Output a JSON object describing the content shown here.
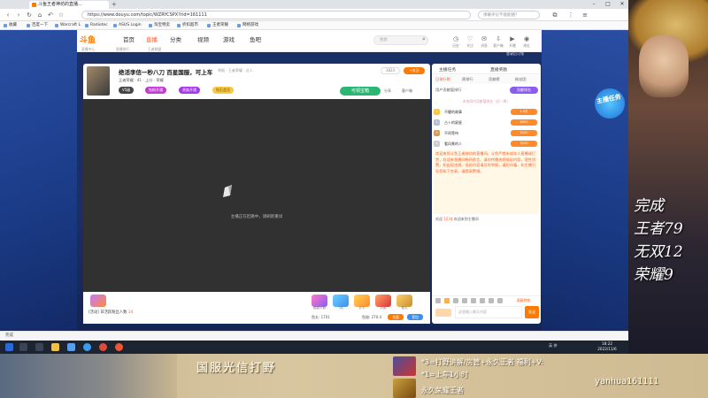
{
  "browser": {
    "tab_title": "斗鱼王者神坊的直播...",
    "url": "https://www.douyu.com/topic/WZRYCSPX?rid=161111",
    "search_placeholder": "弹幕评论不能能播？"
  },
  "bookmarks": [
    "收藏",
    "百度一下",
    "Warcraft L",
    "Radiotec",
    "ASUS Login",
    "淘宝特卖",
    "折扣超市",
    "王者荣耀",
    "网络游戏"
  ],
  "site": {
    "logo": "斗鱼",
    "nav": [
      "首页",
      "直播",
      "分类",
      "视频",
      "游戏",
      "鱼吧"
    ],
    "active_nav": "直播",
    "subnav": [
      "直播中心",
      "直播排行",
      "王者联盟"
    ],
    "search_placeholder": "搜索",
    "header_icons": [
      {
        "icon": "history-icon",
        "label": "历史"
      },
      {
        "icon": "follow-icon",
        "label": "关注"
      },
      {
        "icon": "message-icon",
        "label": "消息"
      },
      {
        "icon": "download-icon",
        "label": "客户端"
      },
      {
        "icon": "live-icon",
        "label": "开播"
      },
      {
        "icon": "location-icon",
        "label": "地址"
      }
    ],
    "login_hint": "登录后可领"
  },
  "room": {
    "title": "绝活李信一秒八刀 百星国服，可上车",
    "tags": "举报 · 王者荣耀 · 达人",
    "meta": "王者荣耀 · 41 · 上分 · 荣耀",
    "pills": [
      "V5级",
      "钻粉开通",
      "贵族开通",
      "钻石会员"
    ],
    "report": "3824",
    "follow": "+关注",
    "treasure": "可领宝箱",
    "share": "分享",
    "client": "客户端",
    "offline_message": "主播正在赶路中，请刷新重试"
  },
  "gifts": [
    "超级火箭",
    "飞机",
    "办卡",
    "火箭",
    "鱼丸",
    "赞"
  ],
  "wallet": {
    "fans_prefix": "[活动]",
    "fans_text": "日活跃粉丝人数",
    "fans_count": "14",
    "fishball": "鱼丸: 1701",
    "fishfin": "鱼翅: 270.4",
    "recharge": "充值",
    "backpack": "背包"
  },
  "chat": {
    "tabs": [
      "主播任务",
      "直播奖励"
    ],
    "subtabs": [
      "日排行榜",
      "周排行",
      "贡献榜",
      "粉丝团"
    ],
    "rank_header": "用户贡献值排行",
    "rank_button": "贡献排名",
    "rank_hint": "本房间内贡献值排名（近一周）",
    "ranks": [
      {
        "num": "1",
        "name": "不醒的故事",
        "badge": "1.6万"
      },
      {
        "num": "2",
        "name": "占卜的星星",
        "badge": "8600"
      },
      {
        "num": "3",
        "name": "不再等待",
        "badge": "5200"
      },
      {
        "num": "4",
        "name": "看风景的人",
        "badge": "3100"
      },
      {
        "num": "5",
        "name": "追梦少年",
        "badge": "2600"
      }
    ],
    "system_notice": "欢迎来到斗鱼王者神坊的直播间。斗鱼严禁未成年人直播或打赏，欢迎来直播间畅所欲言，请勿传播违规低俗内容，理性消费。如出现违规、低俗内容请及时举报。谨防诈骗，如主播引导您私下交易，请提高警惕。",
    "welcome_prefix": "欢迎",
    "welcome_user": "1234",
    "welcome_suffix": "欢迎来到主播间",
    "block": "屏蔽特效",
    "input_placeholder": "这里输入聊天内容",
    "send": "发送"
  },
  "statusbar": "完成",
  "taskbar": {
    "clock_time": "18:22",
    "clock_date": "2022/11/6",
    "tray": "英 拼"
  },
  "overlay": {
    "mission_badge": "主播任务",
    "art_lines": [
      "完成",
      "王者79",
      "无双12",
      "荣耀9"
    ],
    "title": "国服光信打野",
    "line1": "*3=打野讲解/房管+永久王者  福利+V:",
    "line2": "*1=上车1小时",
    "line3": "永久荣耀王者",
    "handle": "yanhua161111"
  }
}
